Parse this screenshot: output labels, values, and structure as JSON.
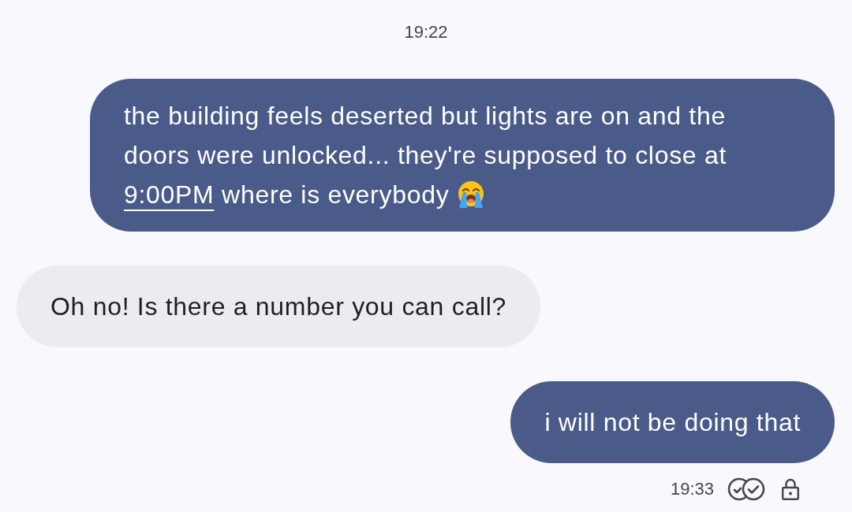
{
  "timestamp": "19:22",
  "messages": [
    {
      "kind": "outgoing",
      "parts": [
        {
          "kind": "text",
          "text": "the building feels deserted but lights are on and the doors were unlocked... they're supposed to close at "
        },
        {
          "kind": "link",
          "text": "9:00PM"
        },
        {
          "kind": "text",
          "text": " where is everybody "
        },
        {
          "kind": "emoji"
        }
      ]
    },
    {
      "kind": "incoming",
      "parts": [
        {
          "kind": "text",
          "text": "Oh no! Is there a number you can call?"
        }
      ]
    },
    {
      "kind": "outgoing",
      "parts": [
        {
          "kind": "text",
          "text": "i will not be doing that"
        }
      ]
    }
  ],
  "footer": {
    "time": "19:33",
    "read": true,
    "encrypted": true
  }
}
